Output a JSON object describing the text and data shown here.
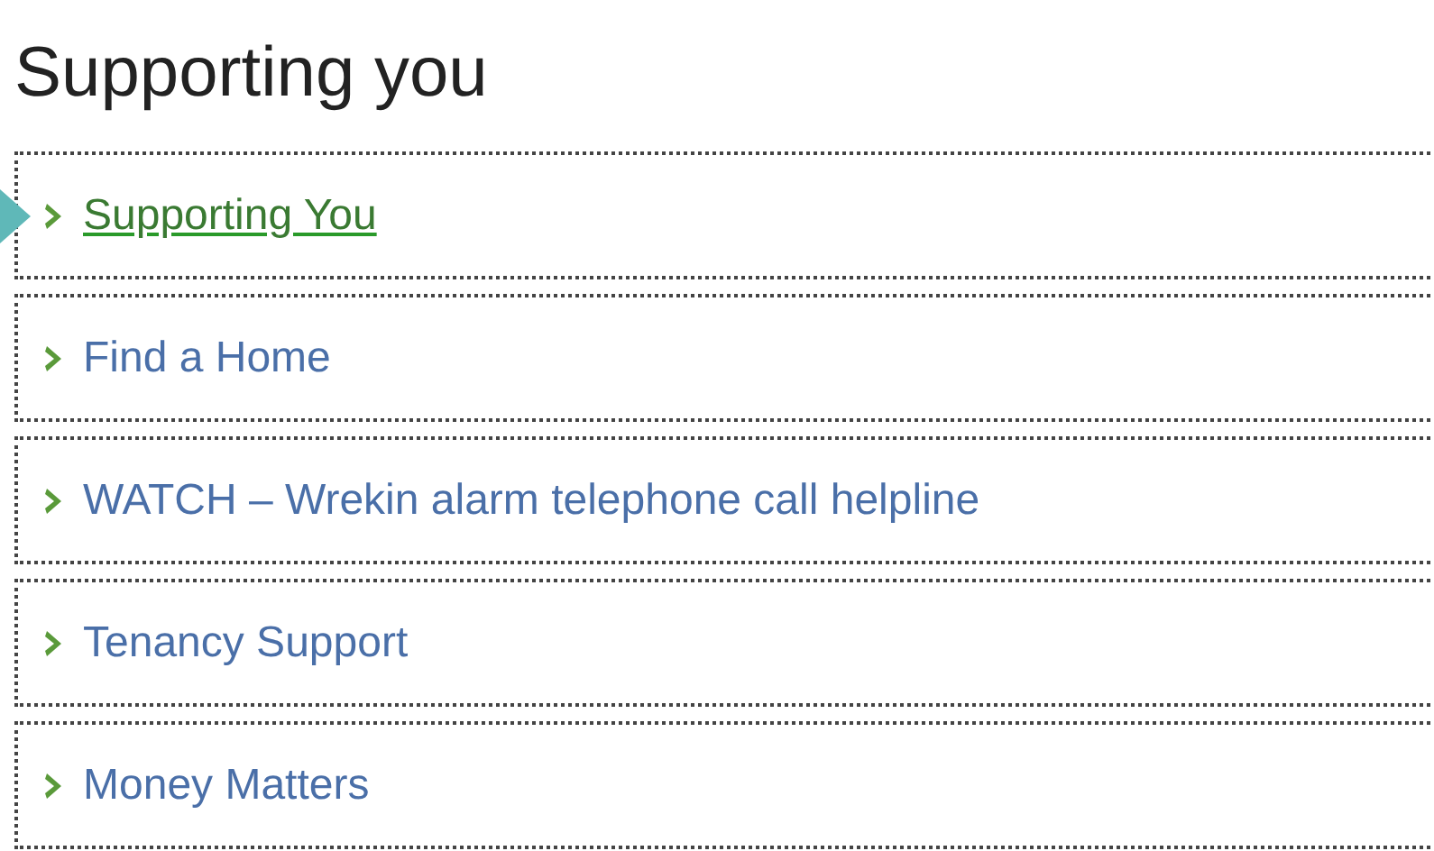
{
  "title": "Supporting you",
  "items": [
    {
      "label": "Supporting You",
      "selected": true
    },
    {
      "label": "Find a Home",
      "selected": false
    },
    {
      "label": "WATCH – Wrekin alarm telephone call helpline",
      "selected": false
    },
    {
      "label": "Tenancy Support",
      "selected": false
    },
    {
      "label": "Money Matters",
      "selected": false
    }
  ]
}
